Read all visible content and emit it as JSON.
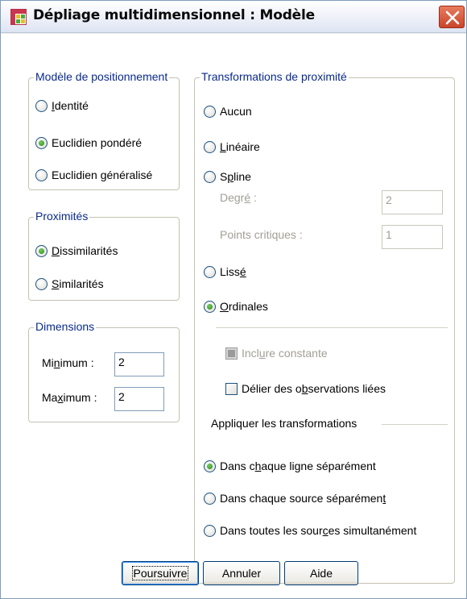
{
  "window": {
    "title": "Dépliage multidimensionnel : Modèle",
    "app_icon": "table-icon",
    "close_icon": "close-icon"
  },
  "model": {
    "title": "Modèle de positionnement",
    "options": [
      {
        "pre": "",
        "u": "I",
        "post": "dentité",
        "selected": false
      },
      {
        "pre": "Euclidien pondéré",
        "u": "",
        "post": "",
        "selected": true
      },
      {
        "pre": "Euclidien ",
        "u": "g",
        "post": "énéralisé",
        "selected": false
      }
    ]
  },
  "proximities": {
    "title": "Proximités",
    "options": [
      {
        "pre": "",
        "u": "D",
        "post": "issimilarités",
        "selected": true
      },
      {
        "pre": "",
        "u": "S",
        "post": "imilarités",
        "selected": false
      }
    ]
  },
  "dimensions": {
    "title": "Dimensions",
    "minimum_pre": "Mi",
    "minimum_u": "n",
    "minimum_post": "imum :",
    "minimum_value": "2",
    "maximum_pre": "Ma",
    "maximum_u": "x",
    "maximum_post": "imum :",
    "maximum_value": "2"
  },
  "transformations": {
    "title": "Transformations de proximité",
    "aucun": {
      "pre": "Aucun",
      "u": "",
      "post": "",
      "selected": false
    },
    "lineaire": {
      "pre": "",
      "u": "L",
      "post": "inéaire",
      "selected": false
    },
    "spline": {
      "pre": "S",
      "u": "p",
      "post": "line",
      "selected": false
    },
    "degree_pre": "Degr",
    "degree_u": "é",
    "degree_post": " :",
    "degree_value": "2",
    "knots_label": "Points critiques :",
    "knots_value": "1",
    "lisse": {
      "pre": "Liss",
      "u": "é",
      "post": "",
      "selected": false
    },
    "ordinales": {
      "pre": "",
      "u": "O",
      "post": "rdinales",
      "selected": true
    },
    "include_constant_pre": "Incl",
    "include_constant_u": "u",
    "include_constant_post": "re constante",
    "untie_pre": "Délier des o",
    "untie_u": "b",
    "untie_post": "servations liées",
    "apply_label": "Appliquer les transformations",
    "apply_options": [
      {
        "pre": "Dans c",
        "u": "h",
        "post": "aque ligne séparément",
        "selected": true
      },
      {
        "pre": "Dans chaque source séparémen",
        "u": "t",
        "post": "",
        "selected": false
      },
      {
        "pre": "Dans toutes les sour",
        "u": "c",
        "post": "es simultanément",
        "selected": false
      }
    ]
  },
  "buttons": {
    "continue": "Poursuivre",
    "cancel": "Annuler",
    "help": "Aide"
  }
}
